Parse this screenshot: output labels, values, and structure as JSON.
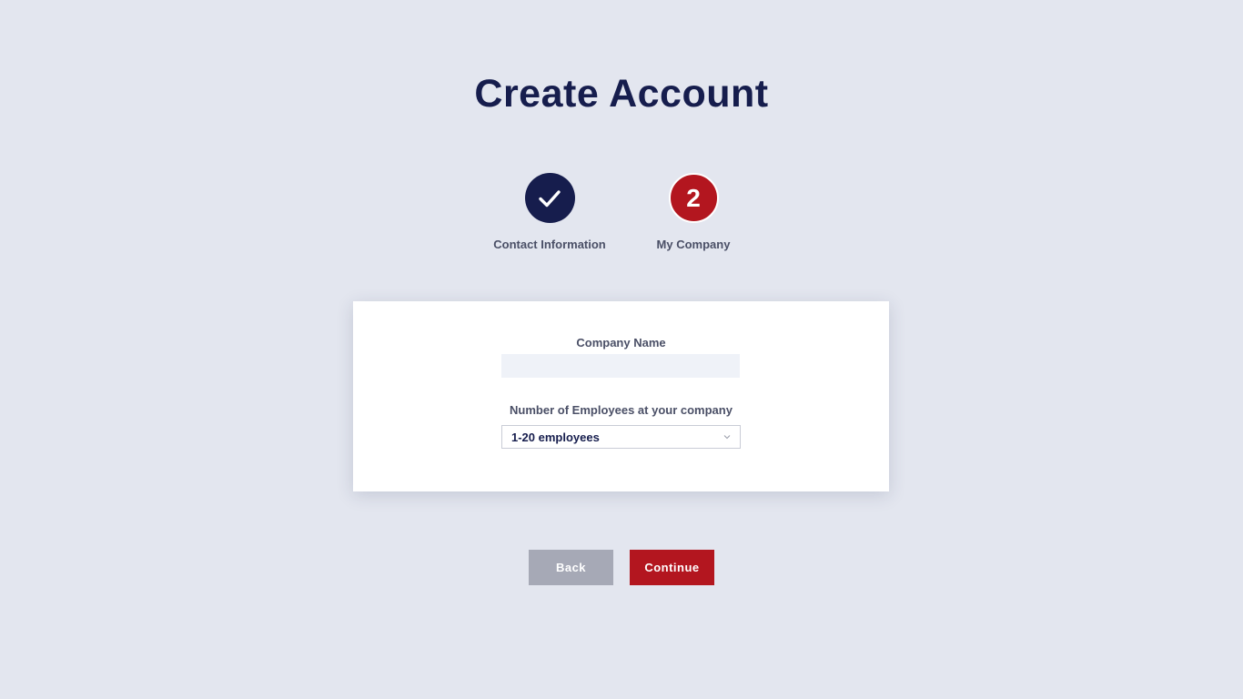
{
  "page": {
    "title": "Create Account"
  },
  "stepper": {
    "steps": [
      {
        "label": "Contact Information",
        "state": "completed",
        "icon": "check-icon"
      },
      {
        "label": "My Company",
        "state": "active",
        "number": "2"
      }
    ]
  },
  "form": {
    "company_name": {
      "label": "Company Name",
      "value": "",
      "placeholder": ""
    },
    "employees": {
      "label": "Number of Employees at your company",
      "selected": "1-20 employees",
      "icon": "chevron-down-icon"
    }
  },
  "actions": {
    "back_label": "Back",
    "continue_label": "Continue"
  },
  "colors": {
    "background": "#e3e6ef",
    "navy": "#161d4d",
    "accent_red": "#b3161f",
    "back_button": "#a6a9b6",
    "input_fill": "#eff2f8"
  }
}
